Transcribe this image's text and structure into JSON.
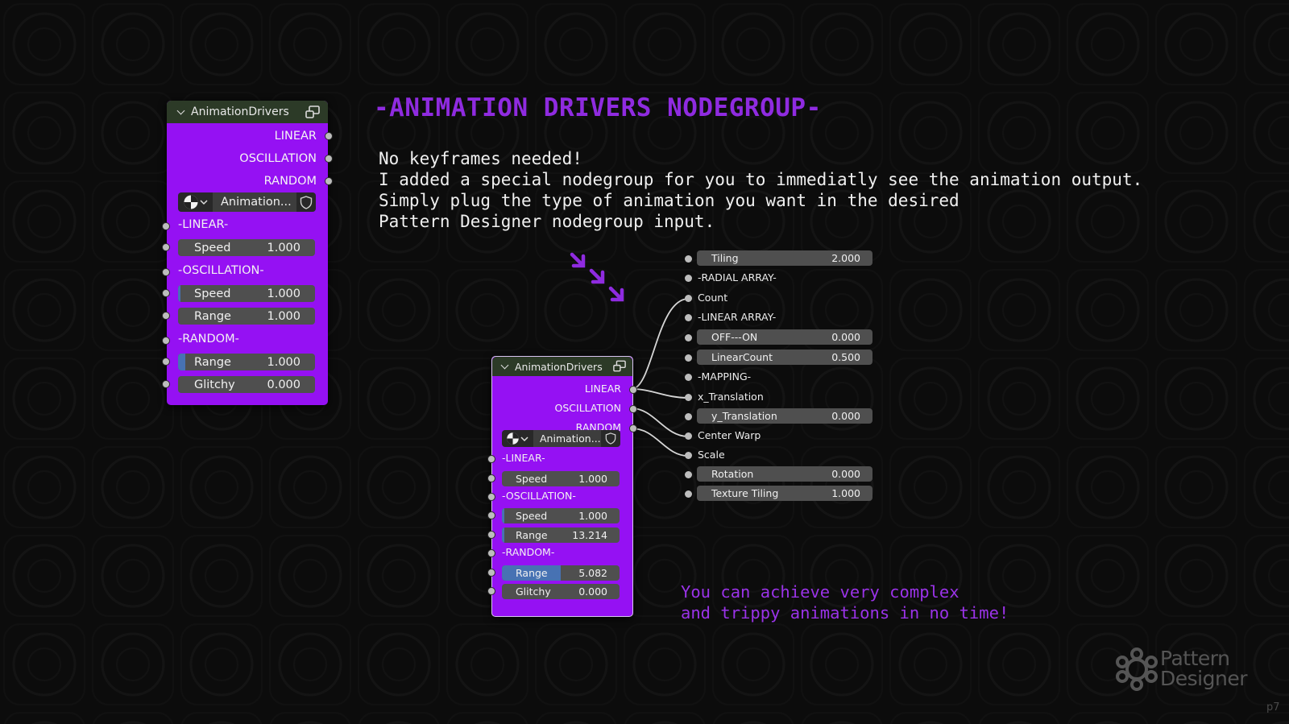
{
  "slide": {
    "title": "-ANIMATION DRIVERS NODEGROUP-",
    "body_lines": [
      "No keyframes needed!",
      "I added a special nodegroup for you to immediatly see the animation output.",
      "Simply plug the type of animation you want in the desired",
      "Pattern Designer nodegroup input."
    ],
    "note_lines": [
      "You can achieve very complex",
      "and trippy animations in no time!"
    ],
    "page_number": "p7",
    "logo_lines": [
      "Pattern",
      "Designer"
    ]
  },
  "colors": {
    "node_body": "#9511f3",
    "node_header": "#2c3a27",
    "title": "#8f2be0",
    "field": "#4f4f4f",
    "field_fill": "#4772b3"
  },
  "node_large": {
    "title": "AnimationDrivers",
    "icon": "node-group-icon",
    "outputs": [
      "LINEAR",
      "OSCILLATION",
      "RANDOM"
    ],
    "selector": {
      "name": "Animation...",
      "icon": "globe-icon",
      "caret": "chevron-down-icon",
      "shield": "shield-icon"
    },
    "sections": {
      "linear": "-LINEAR-",
      "oscillation": "-OSCILLATION-",
      "random": "-RANDOM-"
    },
    "fields": {
      "linear_speed": {
        "name": "Speed",
        "value": "1.000",
        "fill": 0
      },
      "osc_speed": {
        "name": "Speed",
        "value": "1.000",
        "fill": 0.02
      },
      "osc_range": {
        "name": "Range",
        "value": "1.000",
        "fill": 0
      },
      "rand_range": {
        "name": "Range",
        "value": "1.000",
        "fill": 0.05
      },
      "rand_glitchy": {
        "name": "Glitchy",
        "value": "0.000",
        "fill": 0
      }
    }
  },
  "node_small": {
    "title": "AnimationDrivers",
    "icon": "node-group-icon",
    "outputs": [
      "LINEAR",
      "OSCILLATION",
      "RANDOM"
    ],
    "selector": {
      "name": "Animation...",
      "icon": "globe-icon",
      "caret": "chevron-down-icon",
      "shield": "shield-icon"
    },
    "sections": {
      "linear": "-LINEAR-",
      "oscillation": "-OSCILLATION-",
      "random": "-RANDOM-"
    },
    "fields": {
      "linear_speed": {
        "name": "Speed",
        "value": "1.000",
        "fill": 0
      },
      "osc_speed": {
        "name": "Speed",
        "value": "1.000",
        "fill": 0.02
      },
      "osc_range": {
        "name": "Range",
        "value": "13.214",
        "fill": 0.02
      },
      "rand_range": {
        "name": "Range",
        "value": "5.082",
        "fill": 0.5
      },
      "rand_glitchy": {
        "name": "Glitchy",
        "value": "0.000",
        "fill": 0
      }
    }
  },
  "input_panel": {
    "tiling": {
      "name": "Tiling",
      "value": "2.000"
    },
    "radial_array": "-RADIAL ARRAY-",
    "count": "Count",
    "linear_array": "-LINEAR ARRAY-",
    "off_on": {
      "name": "OFF---ON",
      "value": "0.000"
    },
    "linear_count": {
      "name": "LinearCount",
      "value": "0.500"
    },
    "mapping": "-MAPPING-",
    "x_translation": "x_Translation",
    "y_translation": {
      "name": "y_Translation",
      "value": "0.000"
    },
    "center_warp": "Center Warp",
    "scale": "Scale",
    "rotation": {
      "name": "Rotation",
      "value": "0.000"
    },
    "texture_tiling": {
      "name": "Texture Tiling",
      "value": "1.000"
    }
  }
}
